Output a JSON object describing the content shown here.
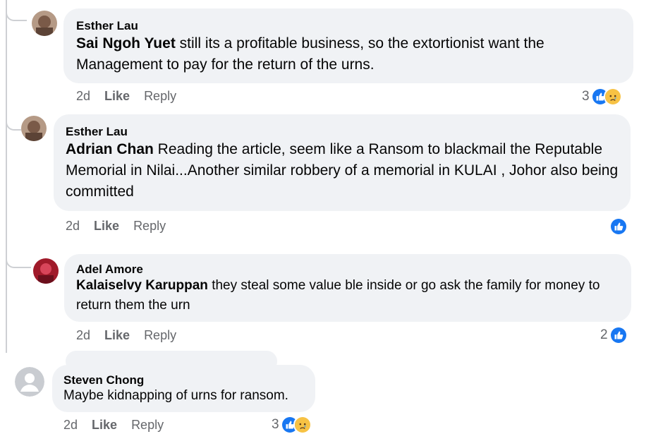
{
  "comments": [
    {
      "author": "Esther Lau",
      "tagged": "Sai Ngoh Yuet",
      "body": " still its a profitable business, so the extortionist want the Management to pay for the return of the urns.",
      "time": "2d",
      "like": "Like",
      "reply": "Reply",
      "reaction_count": "3",
      "reactions": [
        "like-icon",
        "sad-icon"
      ]
    },
    {
      "author": "Esther Lau",
      "tagged": "Adrian Chan",
      "body": " Reading the article, seem like a Ransom to blackmail the Reputable Memorial in Nilai...Another similar robbery of a memorial in KULAI , Johor also being committed",
      "time": "2d",
      "like": "Like",
      "reply": "Reply",
      "reaction_count": "",
      "reactions": [
        "like-icon"
      ]
    },
    {
      "author": "Adel Amore",
      "tagged": "Kalaiselvy Karuppan",
      "body": " they steal some value ble inside or go ask the family for money to return them the urn",
      "time": "2d",
      "like": "Like",
      "reply": "Reply",
      "reaction_count": "2",
      "reactions": [
        "like-icon"
      ]
    },
    {
      "author": "Steven Chong",
      "tagged": "",
      "body": "Maybe kidnapping of urns for ransom.",
      "time": "2d",
      "like": "Like",
      "reply": "Reply",
      "reaction_count": "3",
      "reactions": [
        "like-icon",
        "sad-icon"
      ]
    }
  ],
  "colors": {
    "bubble": "#f0f2f5",
    "meta_text": "#65676b",
    "like_blue": "#1877f2",
    "sad_yellow": "#f7c244",
    "thread_line": "#ced0d4"
  }
}
